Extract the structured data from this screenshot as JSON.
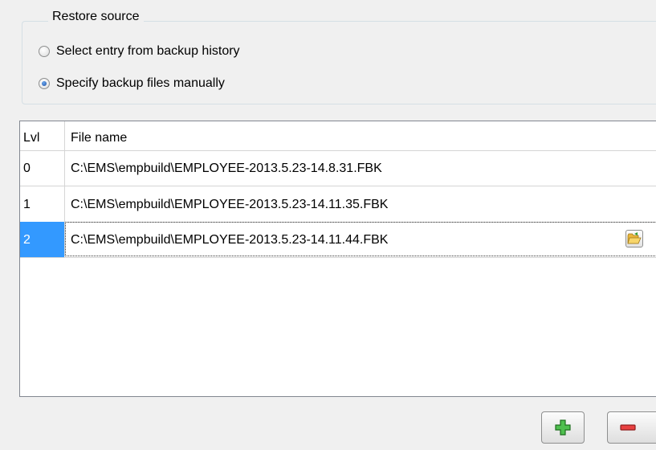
{
  "restore_source": {
    "title": "Restore source",
    "options": [
      {
        "label": "Select entry from backup history",
        "selected": false
      },
      {
        "label": "Specify backup files manually",
        "selected": true
      }
    ]
  },
  "files_grid": {
    "columns": [
      "Lvl",
      "File name"
    ],
    "rows": [
      {
        "lvl": "0",
        "file": "C:\\EMS\\empbuild\\EMPLOYEE-2013.5.23-14.8.31.FBK"
      },
      {
        "lvl": "1",
        "file": "C:\\EMS\\empbuild\\EMPLOYEE-2013.5.23-14.11.35.FBK"
      },
      {
        "lvl": "2",
        "file": "C:\\EMS\\empbuild\\EMPLOYEE-2013.5.23-14.11.44.FBK"
      }
    ],
    "selected_row": 2
  },
  "icons": {
    "browse": "open-folder-icon",
    "add": "plus-icon",
    "remove": "minus-icon"
  },
  "colors": {
    "selection": "#3399ff",
    "add_icon": "#2f9e2f",
    "remove_icon": "#d42b2b"
  }
}
